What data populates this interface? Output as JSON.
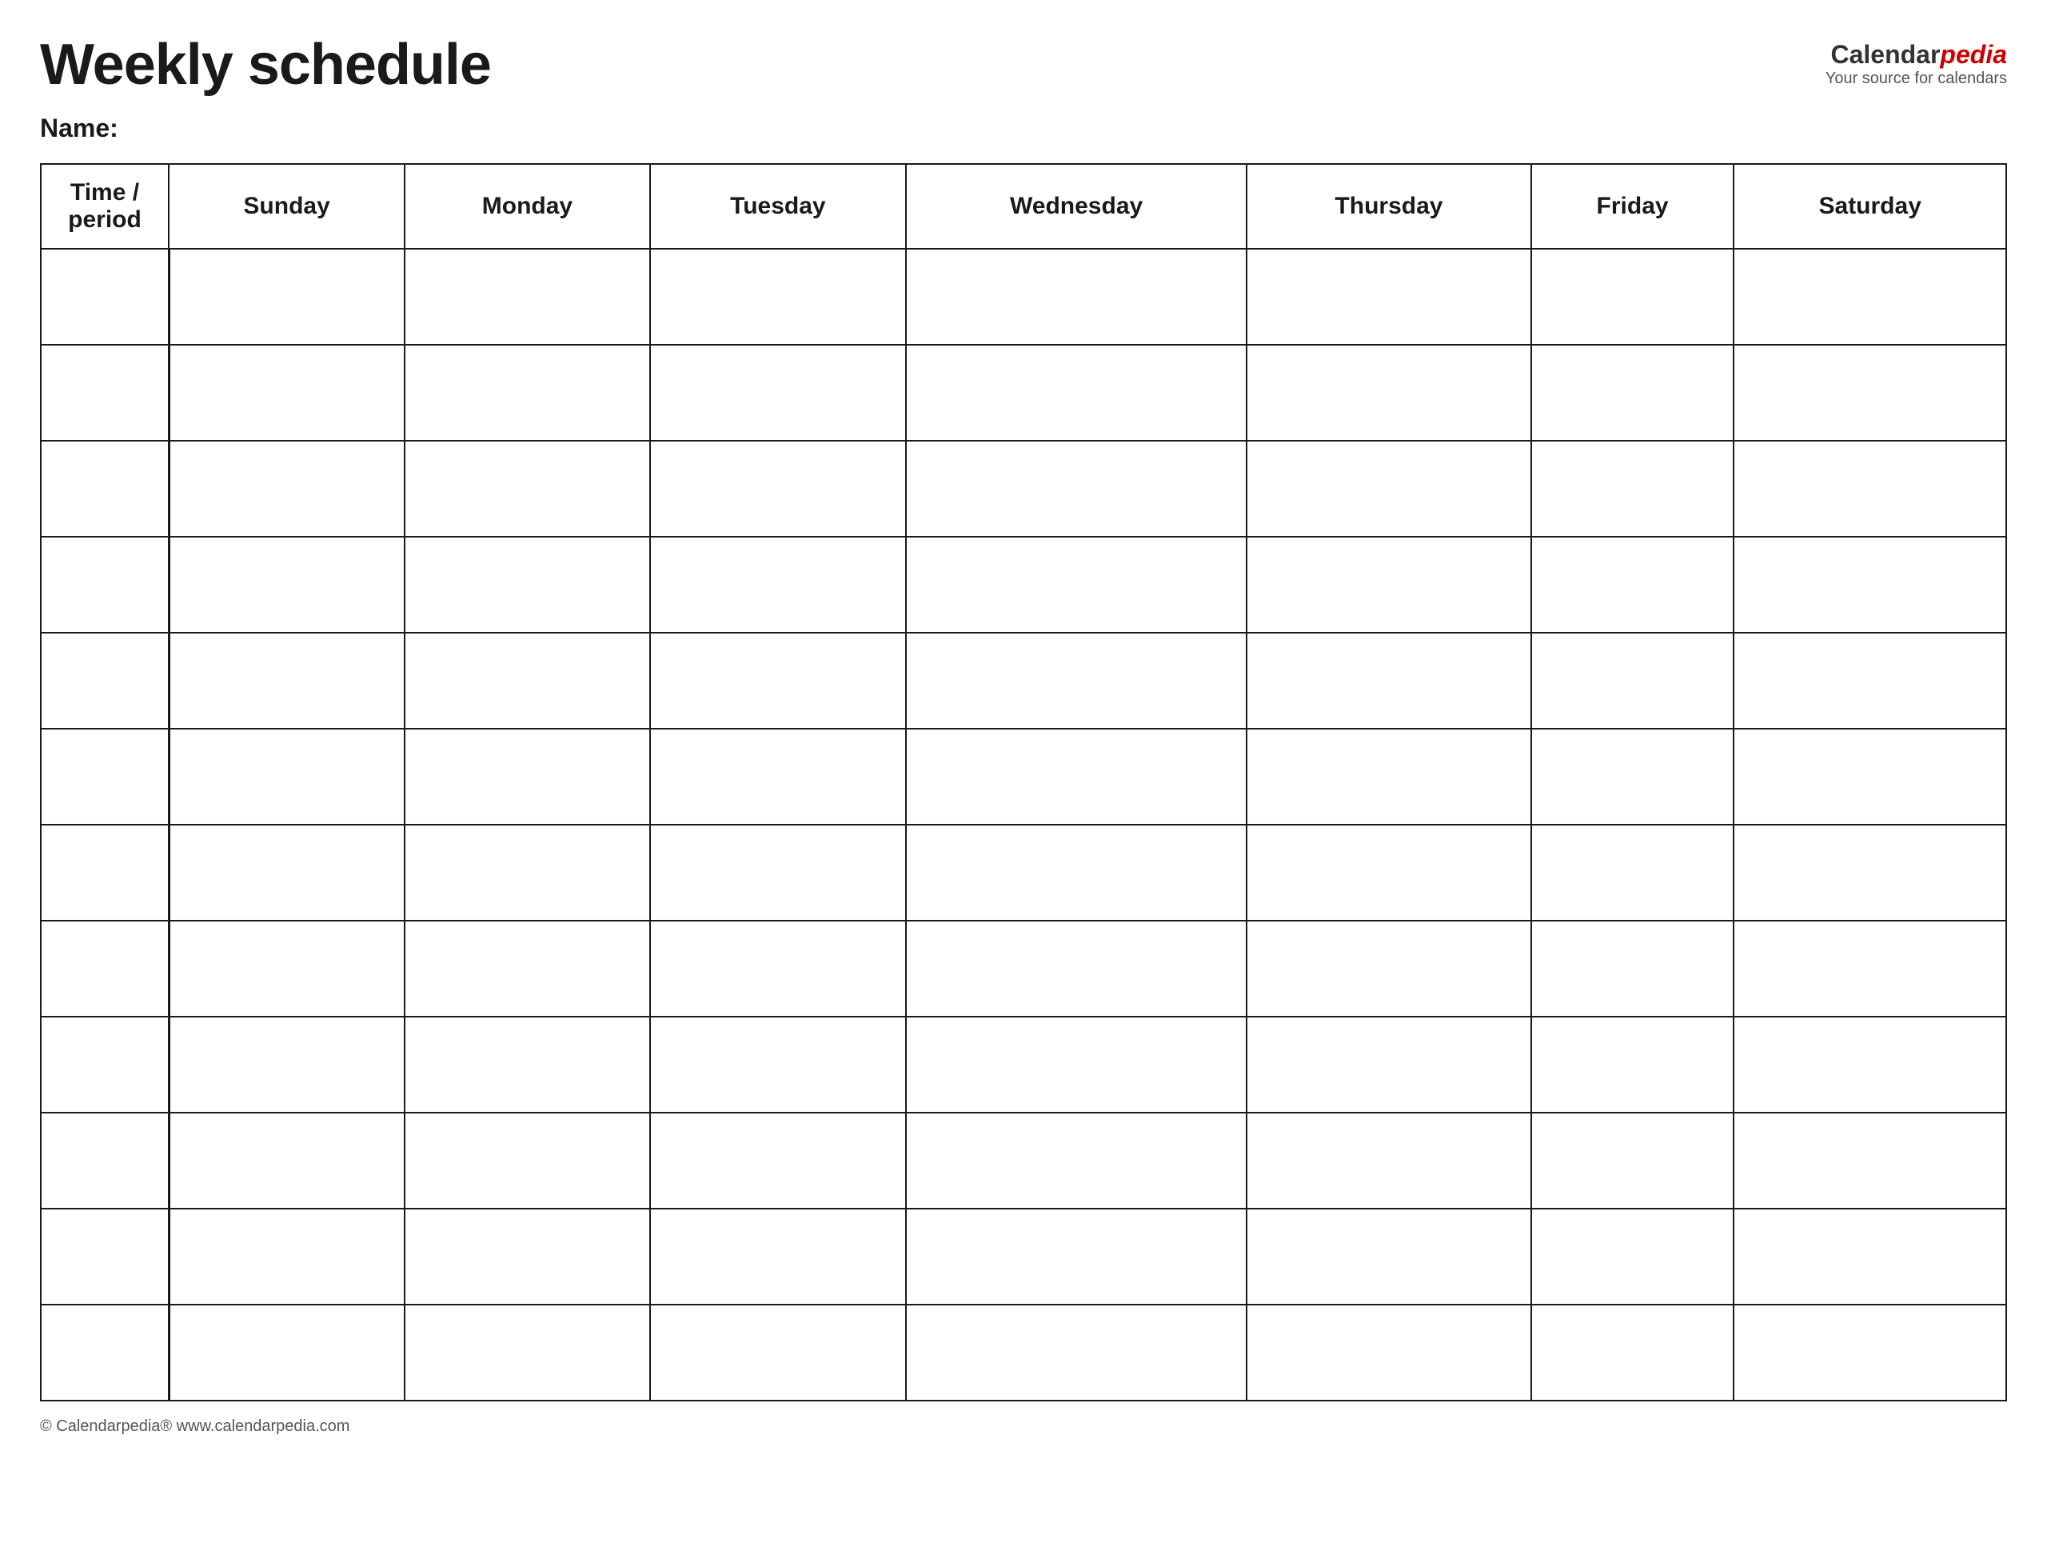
{
  "header": {
    "title": "Weekly schedule",
    "logo": {
      "calendar_text": "Calendar",
      "pedia_text": "pedia",
      "tagline": "Your source for calendars"
    }
  },
  "name_label": "Name:",
  "table": {
    "columns": [
      "Time / period",
      "Sunday",
      "Monday",
      "Tuesday",
      "Wednesday",
      "Thursday",
      "Friday",
      "Saturday"
    ],
    "row_count": 12
  },
  "footer": {
    "text": "© Calendarpedia®  www.calendarpedia.com"
  }
}
